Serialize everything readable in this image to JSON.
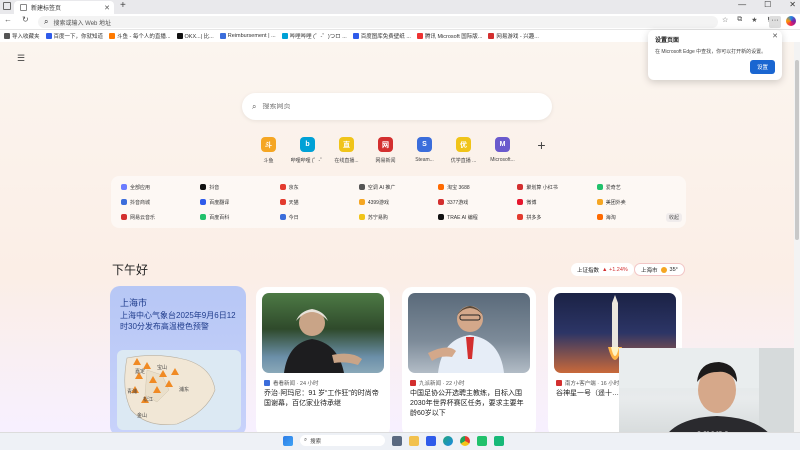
{
  "browser": {
    "tab_title": "新建标签页",
    "tab_close": "✕",
    "new_tab": "+",
    "address_placeholder": "搜索或输入 Web 地址",
    "window_controls": [
      "—",
      "☐",
      "✕"
    ]
  },
  "favorites": [
    {
      "label": "导入收藏夹",
      "color": "#555555"
    },
    {
      "label": "百度一下，你就知道",
      "color": "#2f5bea"
    },
    {
      "label": "斗鱼 - 每个人的直播...",
      "color": "#ff7a00"
    },
    {
      "label": "OKX...| 比...",
      "color": "#111111"
    },
    {
      "label": "Reimbursement | ...",
      "color": "#3b6ddb"
    },
    {
      "label": "哔哩哔哩 (゜-゜)つロ ...",
      "color": "#00a1d6"
    },
    {
      "label": "百度图库免费壁纸 ...",
      "color": "#2f5bea"
    },
    {
      "label": "腾讯 Microsoft 国际版...",
      "color": "#e33"
    },
    {
      "label": "网易游戏 - 兴趣...",
      "color": "#d32f2f"
    }
  ],
  "popup": {
    "title": "设置页面",
    "text": "在 Microsoft Edge 中查找，你可以打开新的设置。",
    "button": "设置",
    "close": "✕"
  },
  "search": {
    "placeholder": "搜索网页"
  },
  "quicklinks": [
    {
      "label": "斗鱼",
      "color": "#f5a623",
      "glyph": "斗"
    },
    {
      "label": "哔哩哔哩 (゜-゜)",
      "color": "#00a1d6",
      "glyph": "b"
    },
    {
      "label": "在线直播...",
      "color": "#f0c419",
      "glyph": "直"
    },
    {
      "label": "网易新闻",
      "color": "#d32f2f",
      "glyph": "网"
    },
    {
      "label": "Steam...",
      "color": "#3b6ddb",
      "glyph": "S"
    },
    {
      "label": "优学直播 ...",
      "color": "#f0c419",
      "glyph": "优"
    },
    {
      "label": "Microsoft...",
      "color": "#6a5acd",
      "glyph": "M"
    }
  ],
  "quicklinks_add": "+",
  "sites": [
    {
      "label": "全部应用",
      "color": "#6b7cff"
    },
    {
      "label": "抖音",
      "color": "#111111"
    },
    {
      "label": "京东",
      "color": "#e33b2e"
    },
    {
      "label": "空调 AI 推广",
      "color": "#555555"
    },
    {
      "label": "淘宝 3688",
      "color": "#ff6a00"
    },
    {
      "label": "聚划算 小红书",
      "color": "#d32f2f"
    },
    {
      "label": "爱奇艺",
      "color": "#21c16b"
    },
    {
      "label": "抖音商城",
      "color": "#3b6ddb"
    },
    {
      "label": "百度翻译",
      "color": "#2f5bea"
    },
    {
      "label": "天猫",
      "color": "#e33b2e"
    },
    {
      "label": "4399游戏",
      "color": "#f5a623"
    },
    {
      "label": "3377游戏",
      "color": "#d32f2f"
    },
    {
      "label": "微博",
      "color": "#e6162d"
    },
    {
      "label": "美团外卖",
      "color": "#f5a623"
    },
    {
      "label": "网易云音乐",
      "color": "#d32f2f"
    },
    {
      "label": "百度百科",
      "color": "#21c16b"
    },
    {
      "label": "今日",
      "color": "#3b6ddb"
    },
    {
      "label": "苏宁易购",
      "color": "#f0c419"
    },
    {
      "label": "TRAE AI 编程",
      "color": "#111111"
    },
    {
      "label": "拼多多",
      "color": "#e33b2e"
    },
    {
      "label": "海淘",
      "color": "#ff6a00"
    }
  ],
  "collapse_label": "收起",
  "greeting": "下午好",
  "market": {
    "label": "上证指数",
    "change": "▲ +1.24%"
  },
  "weather_chip": {
    "city": "上海市",
    "temp": "35°"
  },
  "weather_card": {
    "city": "上海市",
    "text": "上海中心气象台2025年9月6日12时30分发布高温橙色预警"
  },
  "map_labels": [
    "宝山",
    "嘉定",
    "青浦",
    "松江",
    "金山",
    "浦东"
  ],
  "news": [
    {
      "source": "看看新闻 · 24 小时",
      "color": "#3b6ddb",
      "title": "乔治·阿玛尼：91 岁“工作狂”的时尚帝国谢幕，百亿家业待承继"
    },
    {
      "source": "九派新闻 · 22 小时",
      "color": "#d32f2f",
      "title": "中国足协公开选聘主教练，目标入围2030年世界杯赛区任务，要求主要年龄60岁以下"
    },
    {
      "source": "南方+客户端 · 16 小时",
      "color": "#d32f2f",
      "title": "谷神星一号（遥十…"
    }
  ],
  "taskbar": {
    "search": "搜索"
  }
}
